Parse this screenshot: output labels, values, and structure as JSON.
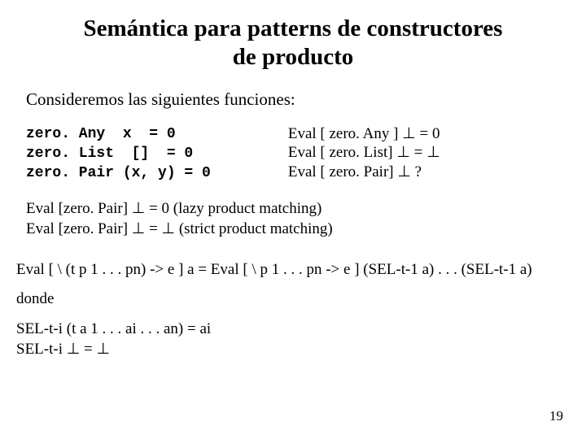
{
  "title_line1": "Semántica para patterns de constructores",
  "title_line2": "de producto",
  "intro": "Consideremos las siguientes funciones:",
  "defs_left": {
    "l1": "zero. Any  x  = 0",
    "l2": "zero. List  []  = 0",
    "l3": "zero. Pair (x, y) = 0"
  },
  "defs_right": {
    "l1": "Eval [ zero. Any ] ⊥ = 0",
    "l2": "Eval [ zero. List] ⊥ = ⊥",
    "l3": "Eval [ zero. Pair] ⊥ ?"
  },
  "matching": {
    "l1": "Eval [zero. Pair] ⊥ = 0   (lazy product matching)",
    "l2": "Eval [zero. Pair] ⊥ = ⊥  (strict product matching)"
  },
  "rule": "Eval [ \\ (t  p 1 . . . pn)  -> e ]  a  =  Eval  [ \\ p 1 . . . pn  -> e ]  (SEL-t-1 a) . . . (SEL-t-1 a)",
  "donde": "donde",
  "sel": {
    "l1": "SEL-t-i  (t  a 1 . . . ai . . . an)  =  ai",
    "l2": "SEL-t-i ⊥ = ⊥"
  },
  "page_number": "19"
}
